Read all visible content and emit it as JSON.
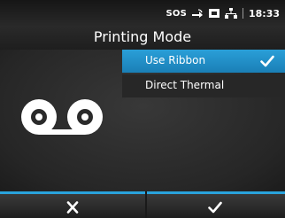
{
  "status_bar": {
    "sos_label": "SOS",
    "icons": [
      "signal-transfer-icon",
      "card-icon",
      "network-icon"
    ],
    "clock": "18:33"
  },
  "header": {
    "title": "Printing Mode"
  },
  "options": [
    {
      "label": "Use Ribbon",
      "selected": true
    },
    {
      "label": "Direct Thermal",
      "selected": false
    }
  ],
  "illustration": "ribbon-icon",
  "footer": {
    "cancel_icon": "close-icon",
    "confirm_icon": "check-icon"
  },
  "colors": {
    "accent": "#2aa3dc",
    "selected_row": "#1f8cc6",
    "background": "#2b2b2b"
  }
}
